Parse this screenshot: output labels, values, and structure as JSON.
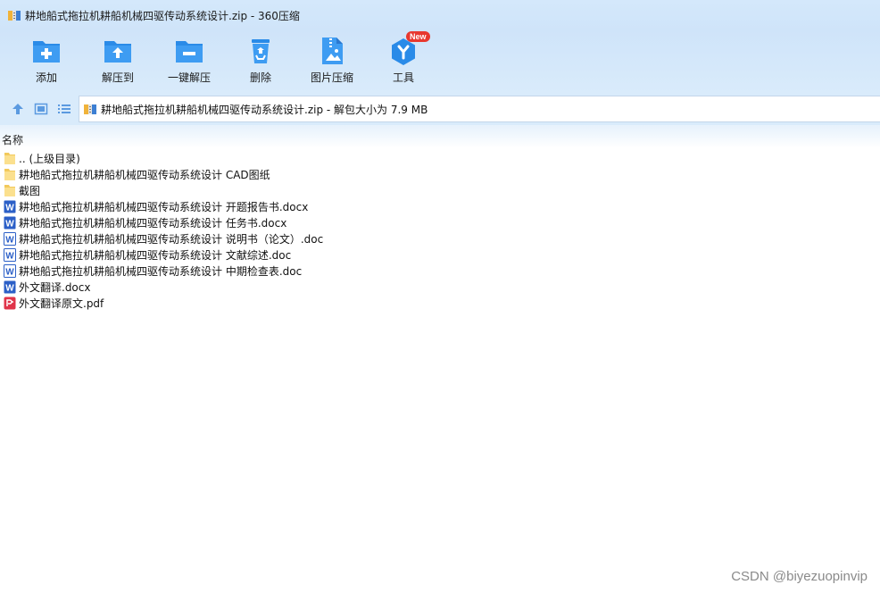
{
  "window": {
    "title": "耕地船式拖拉机耕船机械四驱传动系统设计.zip - 360压缩",
    "app_icon": "archive-icon"
  },
  "toolbar": {
    "items": [
      {
        "label": "添加",
        "icon": "add-folder-icon"
      },
      {
        "label": "解压到",
        "icon": "extract-to-icon"
      },
      {
        "label": "一键解压",
        "icon": "one-click-extract-icon"
      },
      {
        "label": "删除",
        "icon": "recycle-bin-icon"
      },
      {
        "label": "图片压缩",
        "icon": "image-compress-icon"
      },
      {
        "label": "工具",
        "icon": "tools-icon",
        "badge": "New"
      }
    ]
  },
  "addressbar": {
    "path": "耕地船式拖拉机耕船机械四驱传动系统设计.zip - 解包大小为 7.9 MB"
  },
  "list": {
    "column_name": "名称",
    "rows": [
      {
        "name": ".. (上级目录)",
        "type": "folder"
      },
      {
        "name": "耕地船式拖拉机耕船机械四驱传动系统设计 CAD图纸",
        "type": "folder"
      },
      {
        "name": "截图",
        "type": "folder"
      },
      {
        "name": "耕地船式拖拉机耕船机械四驱传动系统设计 开题报告书.docx",
        "type": "docx"
      },
      {
        "name": "耕地船式拖拉机耕船机械四驱传动系统设计 任务书.docx",
        "type": "docx"
      },
      {
        "name": "耕地船式拖拉机耕船机械四驱传动系统设计 说明书（论文）.doc",
        "type": "doc"
      },
      {
        "name": "耕地船式拖拉机耕船机械四驱传动系统设计 文献综述.doc",
        "type": "doc"
      },
      {
        "name": "耕地船式拖拉机耕船机械四驱传动系统设计 中期检查表.doc",
        "type": "doc"
      },
      {
        "name": "外文翻译.docx",
        "type": "docx"
      },
      {
        "name": "外文翻译原文.pdf",
        "type": "pdf"
      }
    ]
  },
  "watermark": "CSDN @biyezuopinvip",
  "colors": {
    "toolbar_bg": "#cfe4f9",
    "icon_blue": "#2a8be8",
    "folder_yellow": "#f7d97a",
    "word_blue": "#2b5fc7",
    "pdf_red": "#e0344a",
    "badge_red": "#e8382f"
  }
}
